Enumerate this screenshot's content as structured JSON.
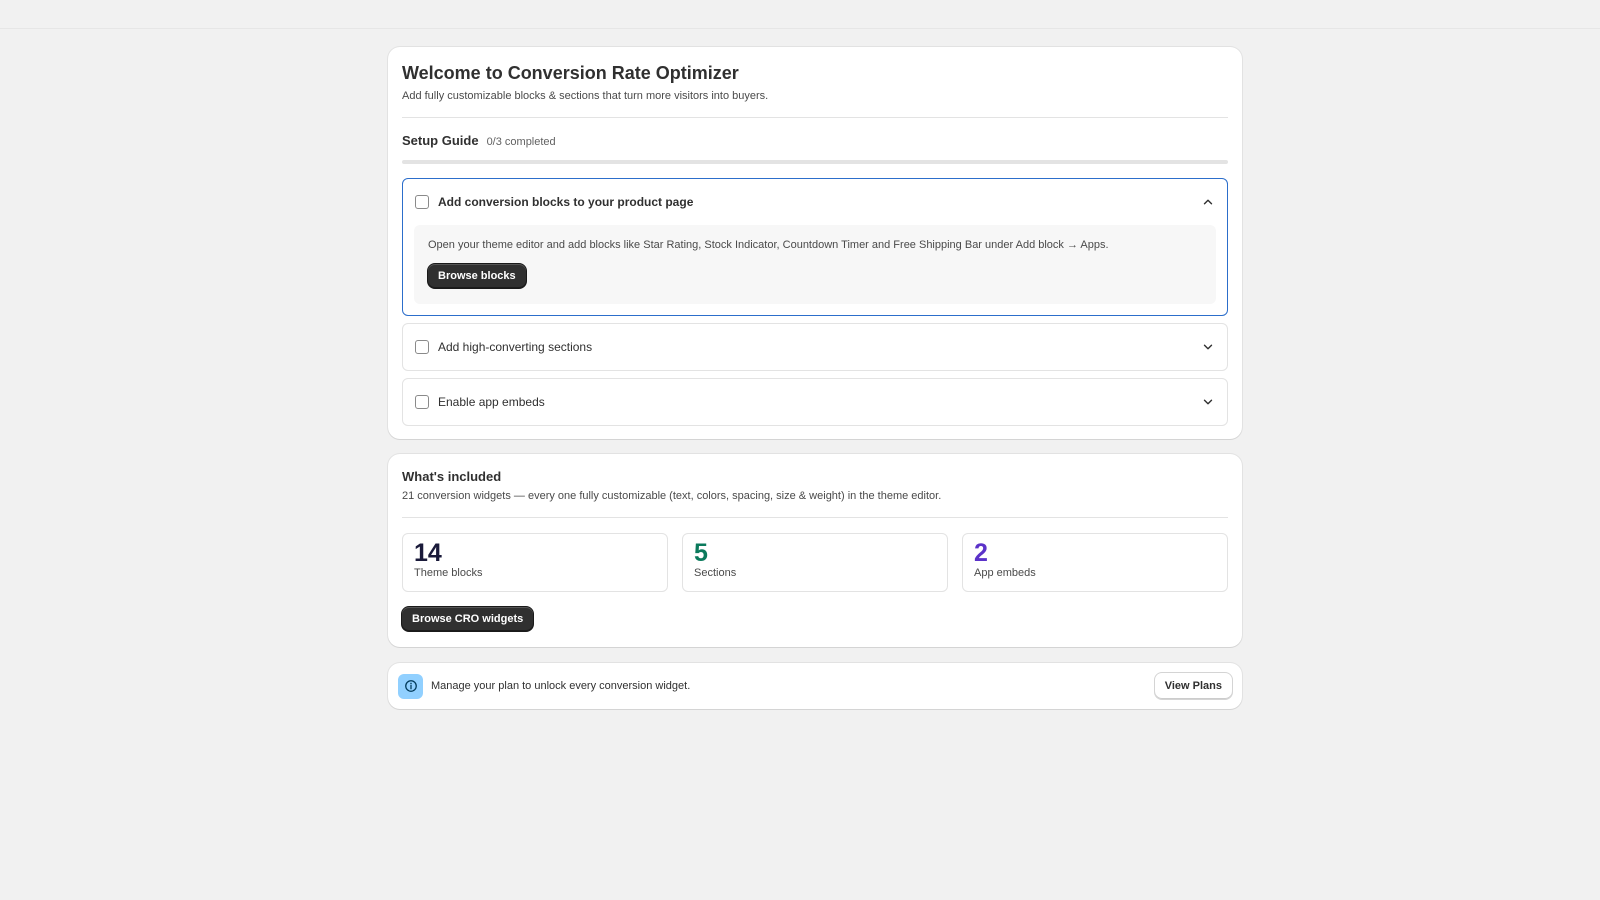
{
  "setup": {
    "title": "Welcome to Conversion Rate Optimizer",
    "subtitle": "Add fully customizable blocks & sections that turn more visitors into buyers.",
    "guide_title": "Setup Guide",
    "guide_count": "0/3 completed",
    "progress_fraction": 0,
    "steps": [
      {
        "label": "Add conversion blocks to your product page",
        "expanded": true,
        "checked": false,
        "description": "Open your theme editor and add blocks like Star Rating, Stock Indicator, Countdown Timer and Free Shipping Bar under Add block → Apps.",
        "button_label": "Browse blocks"
      },
      {
        "label": "Add high-converting sections",
        "expanded": false,
        "checked": false
      },
      {
        "label": "Enable app embeds",
        "expanded": false,
        "checked": false
      }
    ]
  },
  "included": {
    "title": "What's included",
    "subtitle": "21 conversion widgets — every one fully customizable (text, colors, spacing, size & weight) in the theme editor.",
    "stats": [
      {
        "number": "14",
        "label": "Theme blocks",
        "color": "#1a1a3a"
      },
      {
        "number": "5",
        "label": "Sections",
        "color": "#0b7a5c"
      },
      {
        "number": "2",
        "label": "App embeds",
        "color": "#5b32c9"
      }
    ],
    "button_label": "Browse CRO widgets"
  },
  "banner": {
    "icon": "info-icon",
    "text": "Manage your plan to unlock every conversion widget.",
    "button_label": "View Plans"
  },
  "colors": {
    "background": "#f1f1f1",
    "primary_button": "#303030",
    "focus_border": "#2c6ecb",
    "info_badge": "#91d0ff"
  }
}
